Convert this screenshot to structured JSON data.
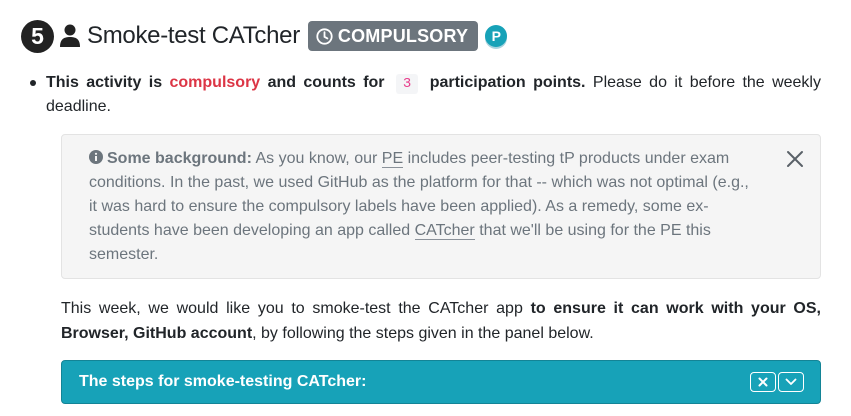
{
  "header": {
    "step_number": "5",
    "title": "Smoke-test CATcher",
    "badge": "COMPULSORY",
    "p_badge": "P"
  },
  "bullet": {
    "part1": "This activity is",
    "compulsory": "compulsory",
    "part2": "and counts for",
    "points": "3",
    "part3": "participation points.",
    "part4": "Please do it before the weekly deadline."
  },
  "notice": {
    "heading": "Some background:",
    "text1": "As you know, our",
    "link_pe": "PE",
    "text2": "includes peer-testing tP products under exam conditions. In the past, we used GitHub as the platform for that -- which was not optimal (e.g., it was hard to ensure the compulsory labels have been applied). As a remedy, some ex-students have been developing an app called",
    "link_catcher": "CATcher",
    "text3": "that we'll be using for the PE this semester."
  },
  "paragraph": {
    "part1": "This week, we would like you to smoke-test the CATcher app",
    "bold": "to ensure it can work with your OS, Browser, GitHub account",
    "part2": ", by following the steps given in the panel below."
  },
  "panel": {
    "title": "The steps for smoke-testing CATcher:"
  },
  "colors": {
    "accent_teal": "#17a2b8",
    "badge_gray": "#6c757d",
    "compulsory_red": "#dc3545",
    "points_pink": "#e83e8c"
  },
  "icons": {
    "person": "person-icon",
    "clock": "clock-icon",
    "info": "info-circle-icon",
    "close": "close-icon",
    "panel_close": "times-icon",
    "panel_expand": "chevron-down-icon"
  }
}
